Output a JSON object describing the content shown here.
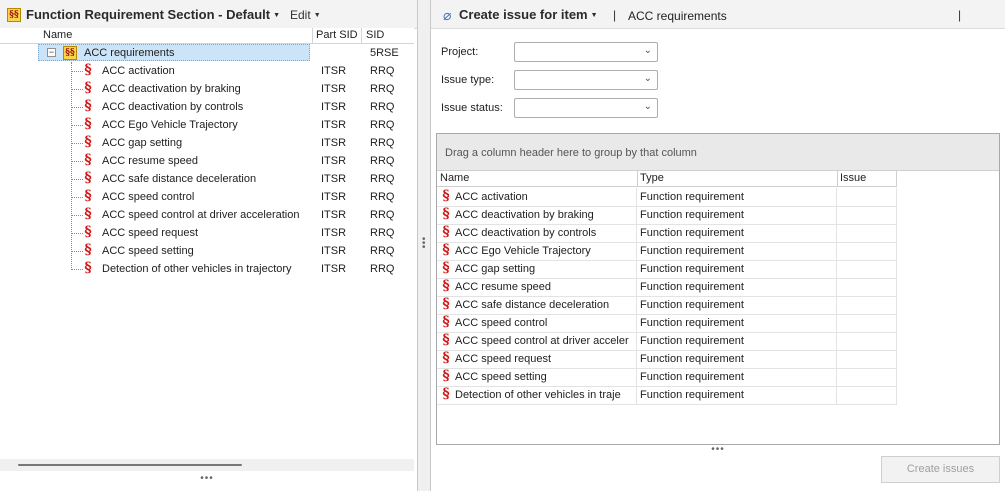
{
  "left": {
    "title": "Function Requirement Section - Default",
    "edit_menu": "Edit",
    "columns": [
      "Name",
      "Part SID",
      "SID"
    ],
    "root": {
      "name": "ACC requirements",
      "sid": "5RSE"
    },
    "items": [
      {
        "name": "ACC activation",
        "part_sid": "ITSR",
        "sid": "RRQ"
      },
      {
        "name": "ACC deactivation by braking",
        "part_sid": "ITSR",
        "sid": "RRQ"
      },
      {
        "name": "ACC deactivation by controls",
        "part_sid": "ITSR",
        "sid": "RRQ"
      },
      {
        "name": "ACC Ego Vehicle Trajectory",
        "part_sid": "ITSR",
        "sid": "RRQ"
      },
      {
        "name": "ACC gap setting",
        "part_sid": "ITSR",
        "sid": "RRQ"
      },
      {
        "name": "ACC resume speed",
        "part_sid": "ITSR",
        "sid": "RRQ"
      },
      {
        "name": "ACC safe distance deceleration",
        "part_sid": "ITSR",
        "sid": "RRQ"
      },
      {
        "name": "ACC speed control",
        "part_sid": "ITSR",
        "sid": "RRQ"
      },
      {
        "name": "ACC speed control at driver acceleration",
        "part_sid": "ITSR",
        "sid": "RRQ"
      },
      {
        "name": "ACC speed request",
        "part_sid": "ITSR",
        "sid": "RRQ"
      },
      {
        "name": "ACC speed setting",
        "part_sid": "ITSR",
        "sid": "RRQ"
      },
      {
        "name": "Detection of other vehicles in trajectory",
        "part_sid": "ITSR",
        "sid": "RRQ"
      }
    ],
    "icons": {
      "section": "section-sign-icon",
      "root": "requirement-folder-icon"
    }
  },
  "right": {
    "title": "Create issue for item",
    "item": "ACC requirements",
    "form": {
      "project_label": "Project:",
      "issue_type_label": "Issue type:",
      "issue_status_label": "Issue status:",
      "project_value": "",
      "issue_type_value": "",
      "issue_status_value": ""
    },
    "group_hint": "Drag a column header here to group by that column",
    "columns": [
      "Name",
      "Type",
      "Issue"
    ],
    "rows": [
      {
        "name": "ACC activation",
        "type": "Function requirement",
        "issue": ""
      },
      {
        "name": "ACC deactivation by braking",
        "type": "Function requirement",
        "issue": ""
      },
      {
        "name": "ACC deactivation by controls",
        "type": "Function requirement",
        "issue": ""
      },
      {
        "name": "ACC Ego Vehicle Trajectory",
        "type": "Function requirement",
        "issue": ""
      },
      {
        "name": "ACC gap setting",
        "type": "Function requirement",
        "issue": ""
      },
      {
        "name": "ACC resume speed",
        "type": "Function requirement",
        "issue": ""
      },
      {
        "name": "ACC safe distance deceleration",
        "type": "Function requirement",
        "issue": ""
      },
      {
        "name": "ACC speed control",
        "type": "Function requirement",
        "issue": ""
      },
      {
        "name": "ACC speed control at driver acceler",
        "type": "Function requirement",
        "issue": ""
      },
      {
        "name": "ACC speed request",
        "type": "Function requirement",
        "issue": ""
      },
      {
        "name": "ACC speed setting",
        "type": "Function requirement",
        "issue": ""
      },
      {
        "name": "Detection of other vehicles in traje",
        "type": "Function requirement",
        "issue": ""
      }
    ],
    "create_button": "Create issues",
    "icons": {
      "title": "paperclip-icon",
      "row": "section-sign-icon"
    }
  },
  "colors": {
    "section_icon": "#d01818",
    "selection": "#cce4f7",
    "accent": "#3d73b8"
  }
}
